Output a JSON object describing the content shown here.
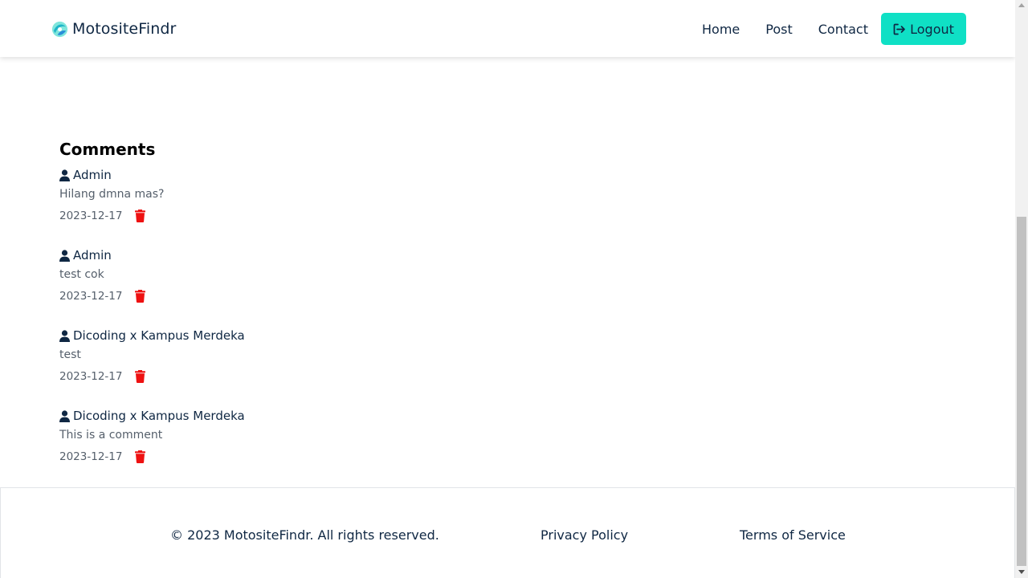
{
  "navbar": {
    "brand": "MotositeFindr",
    "links": [
      "Home",
      "Post",
      "Contact"
    ],
    "logout_label": "Logout"
  },
  "comments_section": {
    "title": "Comments",
    "items": [
      {
        "author": "Admin",
        "text": "Hilang dmna mas?",
        "date": "2023-12-17"
      },
      {
        "author": "Admin",
        "text": "test cok",
        "date": "2023-12-17"
      },
      {
        "author": "Dicoding x Kampus Merdeka",
        "text": "test",
        "date": "2023-12-17"
      },
      {
        "author": "Dicoding x Kampus Merdeka",
        "text": "This is a comment",
        "date": "2023-12-17"
      }
    ]
  },
  "footer": {
    "copyright": "© 2023 MotositeFindr. All rights reserved.",
    "privacy": "Privacy Policy",
    "terms": "Terms of Service"
  },
  "icons": {
    "brand": "motosite-logo-icon",
    "logout": "logout-arrow-icon",
    "author": "user-icon",
    "delete": "trash-icon"
  },
  "colors": {
    "accent": "#0fe0c5",
    "text_dark": "#0f2743",
    "text_muted": "#555f6b",
    "delete_red": "#ee1111"
  }
}
